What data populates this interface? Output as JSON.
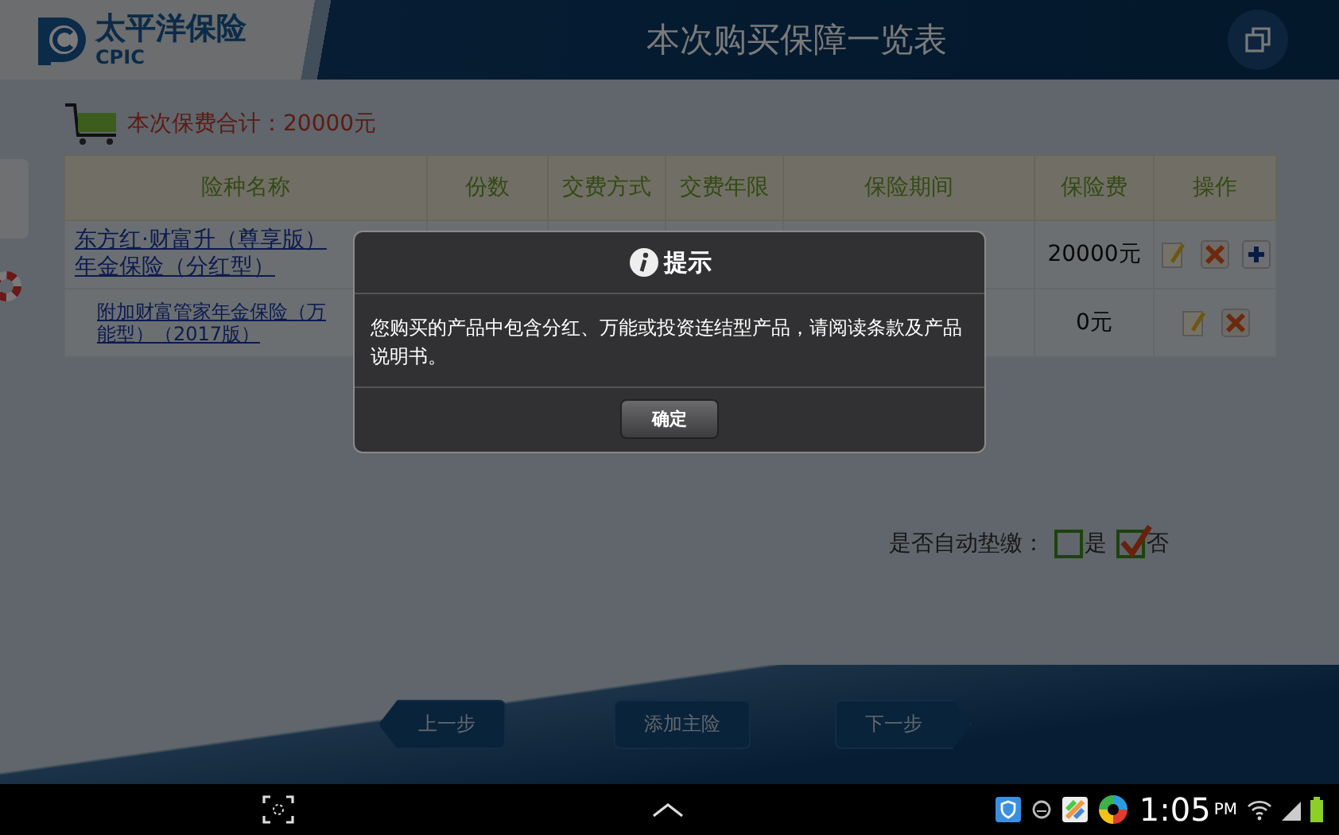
{
  "header": {
    "logo_text": "太平洋保险",
    "logo_subtext": "CPIC",
    "title": "本次购买保障一览表"
  },
  "total": "本次保费合计：20000元",
  "table": {
    "columns": [
      "险种名称",
      "份数",
      "交费方式",
      "交费年限",
      "保险期间",
      "保险费",
      "操作"
    ],
    "rows": [
      {
        "kind": "main",
        "name": "东方红·财富升（尊享版）年金保险（分红型）",
        "premium": "20000元",
        "actions": [
          {
            "kind": "edit"
          },
          {
            "kind": "delete"
          },
          {
            "kind": "add"
          }
        ]
      },
      {
        "kind": "rider",
        "name": "附加财富管家年金保险（万能型）（2017版）",
        "premium": "0元",
        "actions": [
          {
            "kind": "edit"
          },
          {
            "kind": "delete"
          }
        ]
      }
    ]
  },
  "auto_pay": {
    "label": "是否自动垫缴：",
    "options": [
      {
        "label": "是",
        "checked": false
      },
      {
        "label": "否",
        "checked": true
      }
    ]
  },
  "buttons": [
    {
      "kind": "back",
      "label": "上一步"
    },
    {
      "kind": "plain",
      "label": "添加主险"
    },
    {
      "kind": "next",
      "label": "下一步"
    }
  ],
  "dialog": {
    "title": "提示",
    "message": "您购买的产品中包含分红、万能或投资连结型产品，请阅读条款及产品说明书。",
    "button": "确定"
  },
  "status_bar": {
    "time": "1:05",
    "ampm": "PM"
  }
}
